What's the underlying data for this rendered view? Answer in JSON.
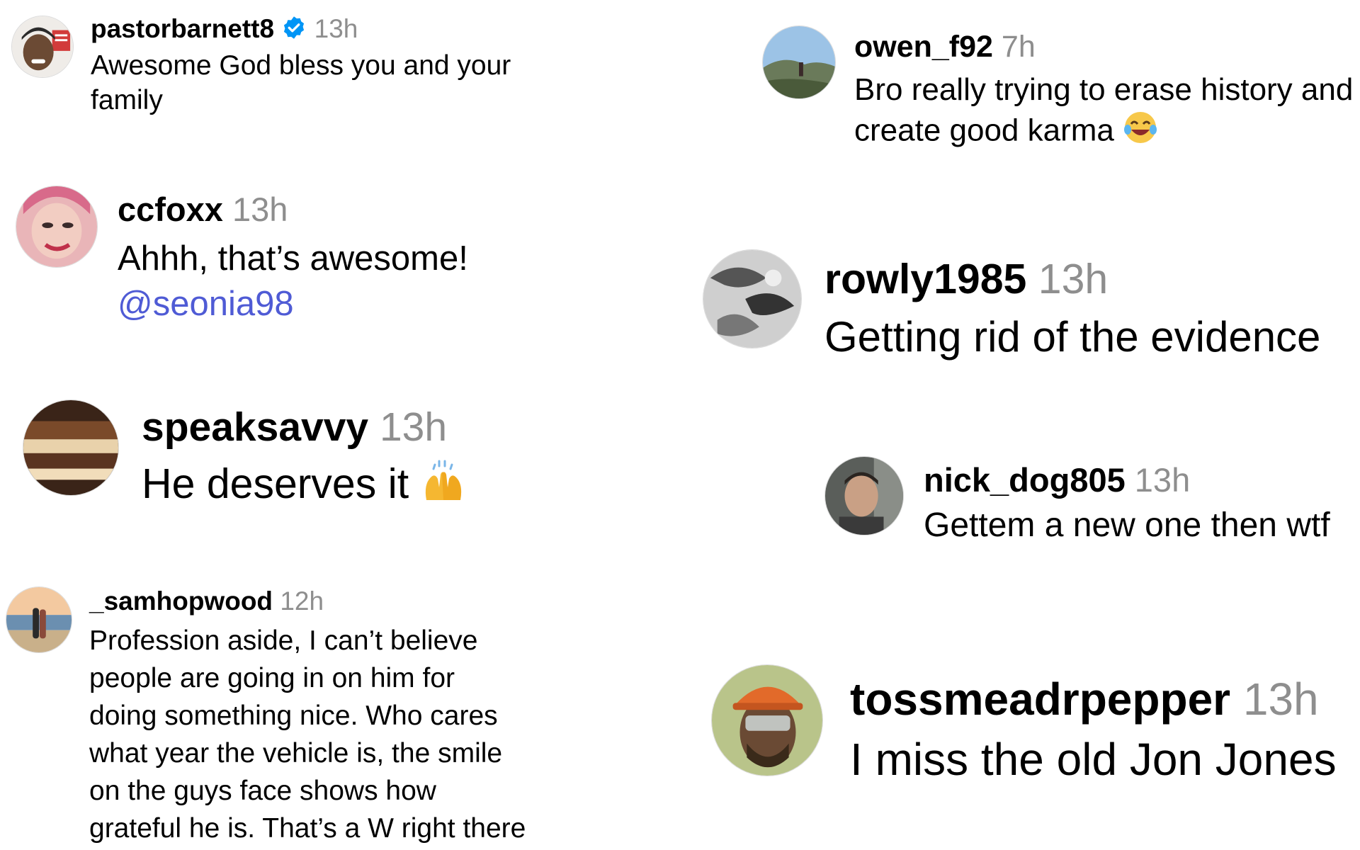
{
  "colors": {
    "username": "#000000",
    "timestamp": "#8e8e8e",
    "mention": "#4f5bd5",
    "verified": "#0095f6"
  },
  "comments": [
    {
      "username": "pastorbarnett8",
      "verified": true,
      "time": "13h",
      "lines": [
        "Awesome God bless you and your",
        "family"
      ]
    },
    {
      "username": "ccfoxx",
      "time": "13h",
      "lines": [
        "Ahhh, that’s awesome!"
      ],
      "mention": "@seonia98"
    },
    {
      "username": "speaksavvy",
      "time": "13h",
      "lines": [
        "He deserves it"
      ],
      "emoji": "raising-hands-emoji"
    },
    {
      "username": "_samhopwood",
      "time": "12h",
      "lines": [
        "Profession aside, I can’t believe",
        "people are going in on him for",
        "doing something nice. Who cares",
        "what year the vehicle is, the smile",
        "on the guys face shows how",
        "grateful he is. That’s a W right there"
      ]
    },
    {
      "username": "owen_f92",
      "time": "7h",
      "lines": [
        "Bro really trying to erase history and",
        "create good karma"
      ],
      "emoji": "laughing-emoji"
    },
    {
      "username": "rowly1985",
      "time": "13h",
      "lines": [
        "Getting rid of the evidence"
      ]
    },
    {
      "username": "nick_dog805",
      "time": "13h",
      "lines": [
        "Gettem a new one then wtf"
      ]
    },
    {
      "username": "tossmeadrpepper",
      "time": "13h",
      "lines": [
        "I miss the old Jon Jones"
      ]
    }
  ]
}
